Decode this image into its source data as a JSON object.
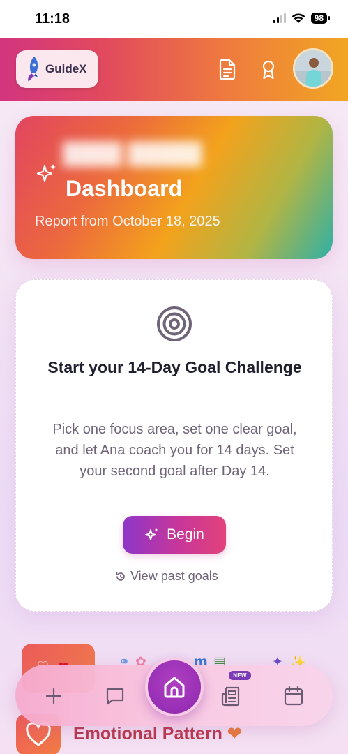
{
  "status_bar": {
    "time": "11:18",
    "battery": "98"
  },
  "header": {
    "logo_text": "GuideX",
    "icons": [
      "report-icon",
      "award-icon"
    ],
    "avatar": "user-avatar"
  },
  "dashboard": {
    "title": "Dashboard",
    "subtitle": "Report from October 18, 2025"
  },
  "goal_card": {
    "title": "Start your 14-Day Goal Challenge",
    "description": "Pick one focus area, set one clear goal, and let Ana coach you for 14 days. Set your second goal after Day 14.",
    "begin_label": "Begin",
    "past_goals_label": "View past goals"
  },
  "emotional_pattern": {
    "title": "Emotional Pattern"
  },
  "bottom_nav": {
    "items": [
      "add",
      "chat",
      "home",
      "journal",
      "calendar"
    ],
    "new_badge": "NEW"
  },
  "colors": {
    "accent_purple": "#8e36c9",
    "accent_pink": "#e2427a",
    "header_start": "#d3357e",
    "header_end": "#f1a623"
  }
}
